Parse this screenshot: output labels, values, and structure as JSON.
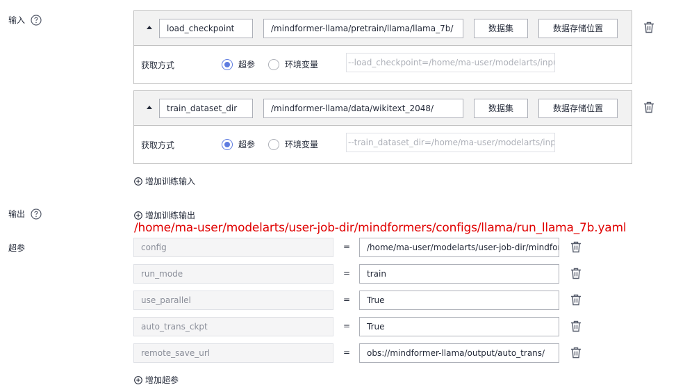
{
  "input_section": {
    "label": "输入"
  },
  "output_section": {
    "label": "输出"
  },
  "hyperparams_section": {
    "label": "超参"
  },
  "inputs": [
    {
      "name": "load_checkpoint",
      "path": "/mindformer-llama/pretrain/llama/llama_7b/",
      "dataset_button": "数据集",
      "storage_button": "数据存储位置",
      "method_label": "获取方式",
      "radio_hyperparam": "超参",
      "radio_env": "环境变量",
      "selected": "超参",
      "preview": "--load_checkpoint=/home/ma-user/modelarts/inputs..."
    },
    {
      "name": "train_dataset_dir",
      "path": "/mindformer-llama/data/wikitext_2048/",
      "dataset_button": "数据集",
      "storage_button": "数据存储位置",
      "method_label": "获取方式",
      "radio_hyperparam": "超参",
      "radio_env": "环境变量",
      "selected": "超参",
      "preview": "--train_dataset_dir=/home/ma-user/modelarts/input..."
    }
  ],
  "add_input_label": "增加训练输入",
  "add_output_label": "增加训练输出",
  "annotation_path": "/home/ma-user/modelarts/user-job-dir/mindformers/configs/llama/run_llama_7b.yaml",
  "equals_sign": "=",
  "hyperparams": [
    {
      "key": "config",
      "value": "/home/ma-user/modelarts/user-job-dir/mindform"
    },
    {
      "key": "run_mode",
      "value": "train"
    },
    {
      "key": "use_parallel",
      "value": "True"
    },
    {
      "key": "auto_trans_ckpt",
      "value": "True"
    },
    {
      "key": "remote_save_url",
      "value": "obs://mindformer-llama/output/auto_trans/"
    }
  ],
  "add_hyperparam_label": "增加超参",
  "colors": {
    "accent": "#5e7ce0",
    "annotation": "#e00000",
    "border": "#c2c2c2",
    "header_bg": "#f2f2f2"
  },
  "icons": {
    "help": "help-circle-icon",
    "delete": "trash-icon",
    "add": "plus-circle-icon",
    "collapse": "caret-up-icon"
  }
}
